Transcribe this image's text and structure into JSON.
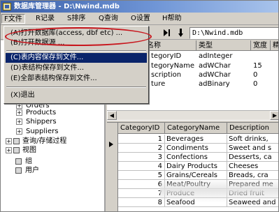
{
  "window": {
    "title": "数据库管理器 - D:\\Nwind.mdb"
  },
  "menubar": {
    "items": [
      {
        "label": "F文件"
      },
      {
        "label": "R记录"
      },
      {
        "label": "S排序"
      },
      {
        "label": "Q查询"
      },
      {
        "label": "O设置"
      },
      {
        "label": "H帮助"
      }
    ]
  },
  "toolbar": {
    "path_value": "D:\\Nwind.mdb"
  },
  "file_menu": {
    "items": [
      {
        "label": "(A)打开数据库(access, dbf etc) ..."
      },
      {
        "label": "(B)打开数据源 ..."
      },
      {
        "label": "(C)表内容保存到文件..."
      },
      {
        "label": "(D)表结构保存到文件..."
      },
      {
        "label": "(E)全部表结构保存到文件..."
      },
      {
        "label": "(X)退出"
      }
    ]
  },
  "tree": {
    "items": [
      {
        "label": "Orders"
      },
      {
        "label": "Products"
      },
      {
        "label": "Shippers"
      },
      {
        "label": "Suppliers"
      },
      {
        "label": "查询/存储过程"
      },
      {
        "label": "视图"
      },
      {
        "label": "组"
      },
      {
        "label": "用户"
      }
    ]
  },
  "fields": {
    "headers": [
      "名称",
      "类型",
      "宽度",
      "精"
    ],
    "rows": [
      {
        "name": "tegoryID",
        "type": "adInteger",
        "width": ""
      },
      {
        "name": "tegoryName",
        "type": "adWChar",
        "width": "15"
      },
      {
        "name": "scription",
        "type": "adWChar",
        "width": "0"
      },
      {
        "name": "ture",
        "type": "adBinary",
        "width": "0"
      }
    ]
  },
  "grid": {
    "headers": [
      "CategoryID",
      "CategoryName",
      "Description"
    ],
    "rows": [
      {
        "id": "1",
        "name": "Beverages",
        "desc": "Soft drinks,"
      },
      {
        "id": "2",
        "name": "Condiments",
        "desc": "Sweet and s"
      },
      {
        "id": "3",
        "name": "Confections",
        "desc": "Desserts, ca"
      },
      {
        "id": "4",
        "name": "Dairy Products",
        "desc": "Cheeses"
      },
      {
        "id": "5",
        "name": "Grains/Cereals",
        "desc": "Breads, cra"
      },
      {
        "id": "6",
        "name": "Meat/Poultry",
        "desc": "Prepared me"
      },
      {
        "id": "7",
        "name": "Produce",
        "desc": "Dried fruit"
      },
      {
        "id": "8",
        "name": "Seafood",
        "desc": "Seaweed and"
      }
    ]
  },
  "colors": {
    "highlight": "#0a246a",
    "annotation": "#c8161d",
    "face": "#d4d0c8"
  }
}
